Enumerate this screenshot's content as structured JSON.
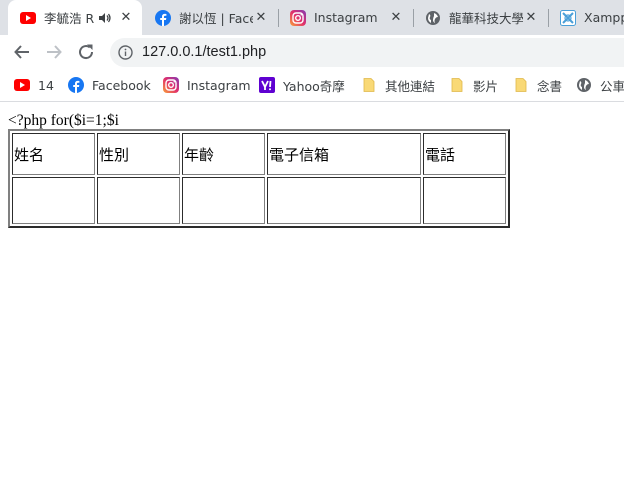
{
  "tabs": [
    {
      "title": "李毓浩 R",
      "icon": "youtube-icon",
      "active": true,
      "audio": true
    },
    {
      "title": "謝以恆 | Face",
      "icon": "facebook-icon"
    },
    {
      "title": "Instagram",
      "icon": "instagram-icon"
    },
    {
      "title": "龍華科技大學",
      "icon": "globe-icon"
    },
    {
      "title": "Xampp.",
      "icon": "xampp-icon"
    }
  ],
  "toolbar": {
    "url": "127.0.0.1/test1.php"
  },
  "bookmarks": [
    {
      "label": "14",
      "icon": "youtube-icon"
    },
    {
      "label": "Facebook",
      "icon": "facebook-icon"
    },
    {
      "label": "Instagram",
      "icon": "instagram-icon"
    },
    {
      "label": "Yahoo奇摩",
      "icon": "yahoo-icon"
    },
    {
      "label": "其他連結",
      "icon": "folder-icon"
    },
    {
      "label": "影片",
      "icon": "folder-icon"
    },
    {
      "label": "念書",
      "icon": "folder-icon"
    },
    {
      "label": "公車",
      "icon": "globe-icon"
    }
  ],
  "page": {
    "php_text": "<?php for($i=1;$i",
    "headers": [
      "姓名",
      "性別",
      "年齡",
      "電子信箱",
      "電話"
    ]
  },
  "colors": {
    "tabstrip": "#dee1e6",
    "youtube": "#ff0000",
    "facebook": "#1877f2",
    "yahoo": "#5f01d1",
    "folder": "#f9d976"
  }
}
